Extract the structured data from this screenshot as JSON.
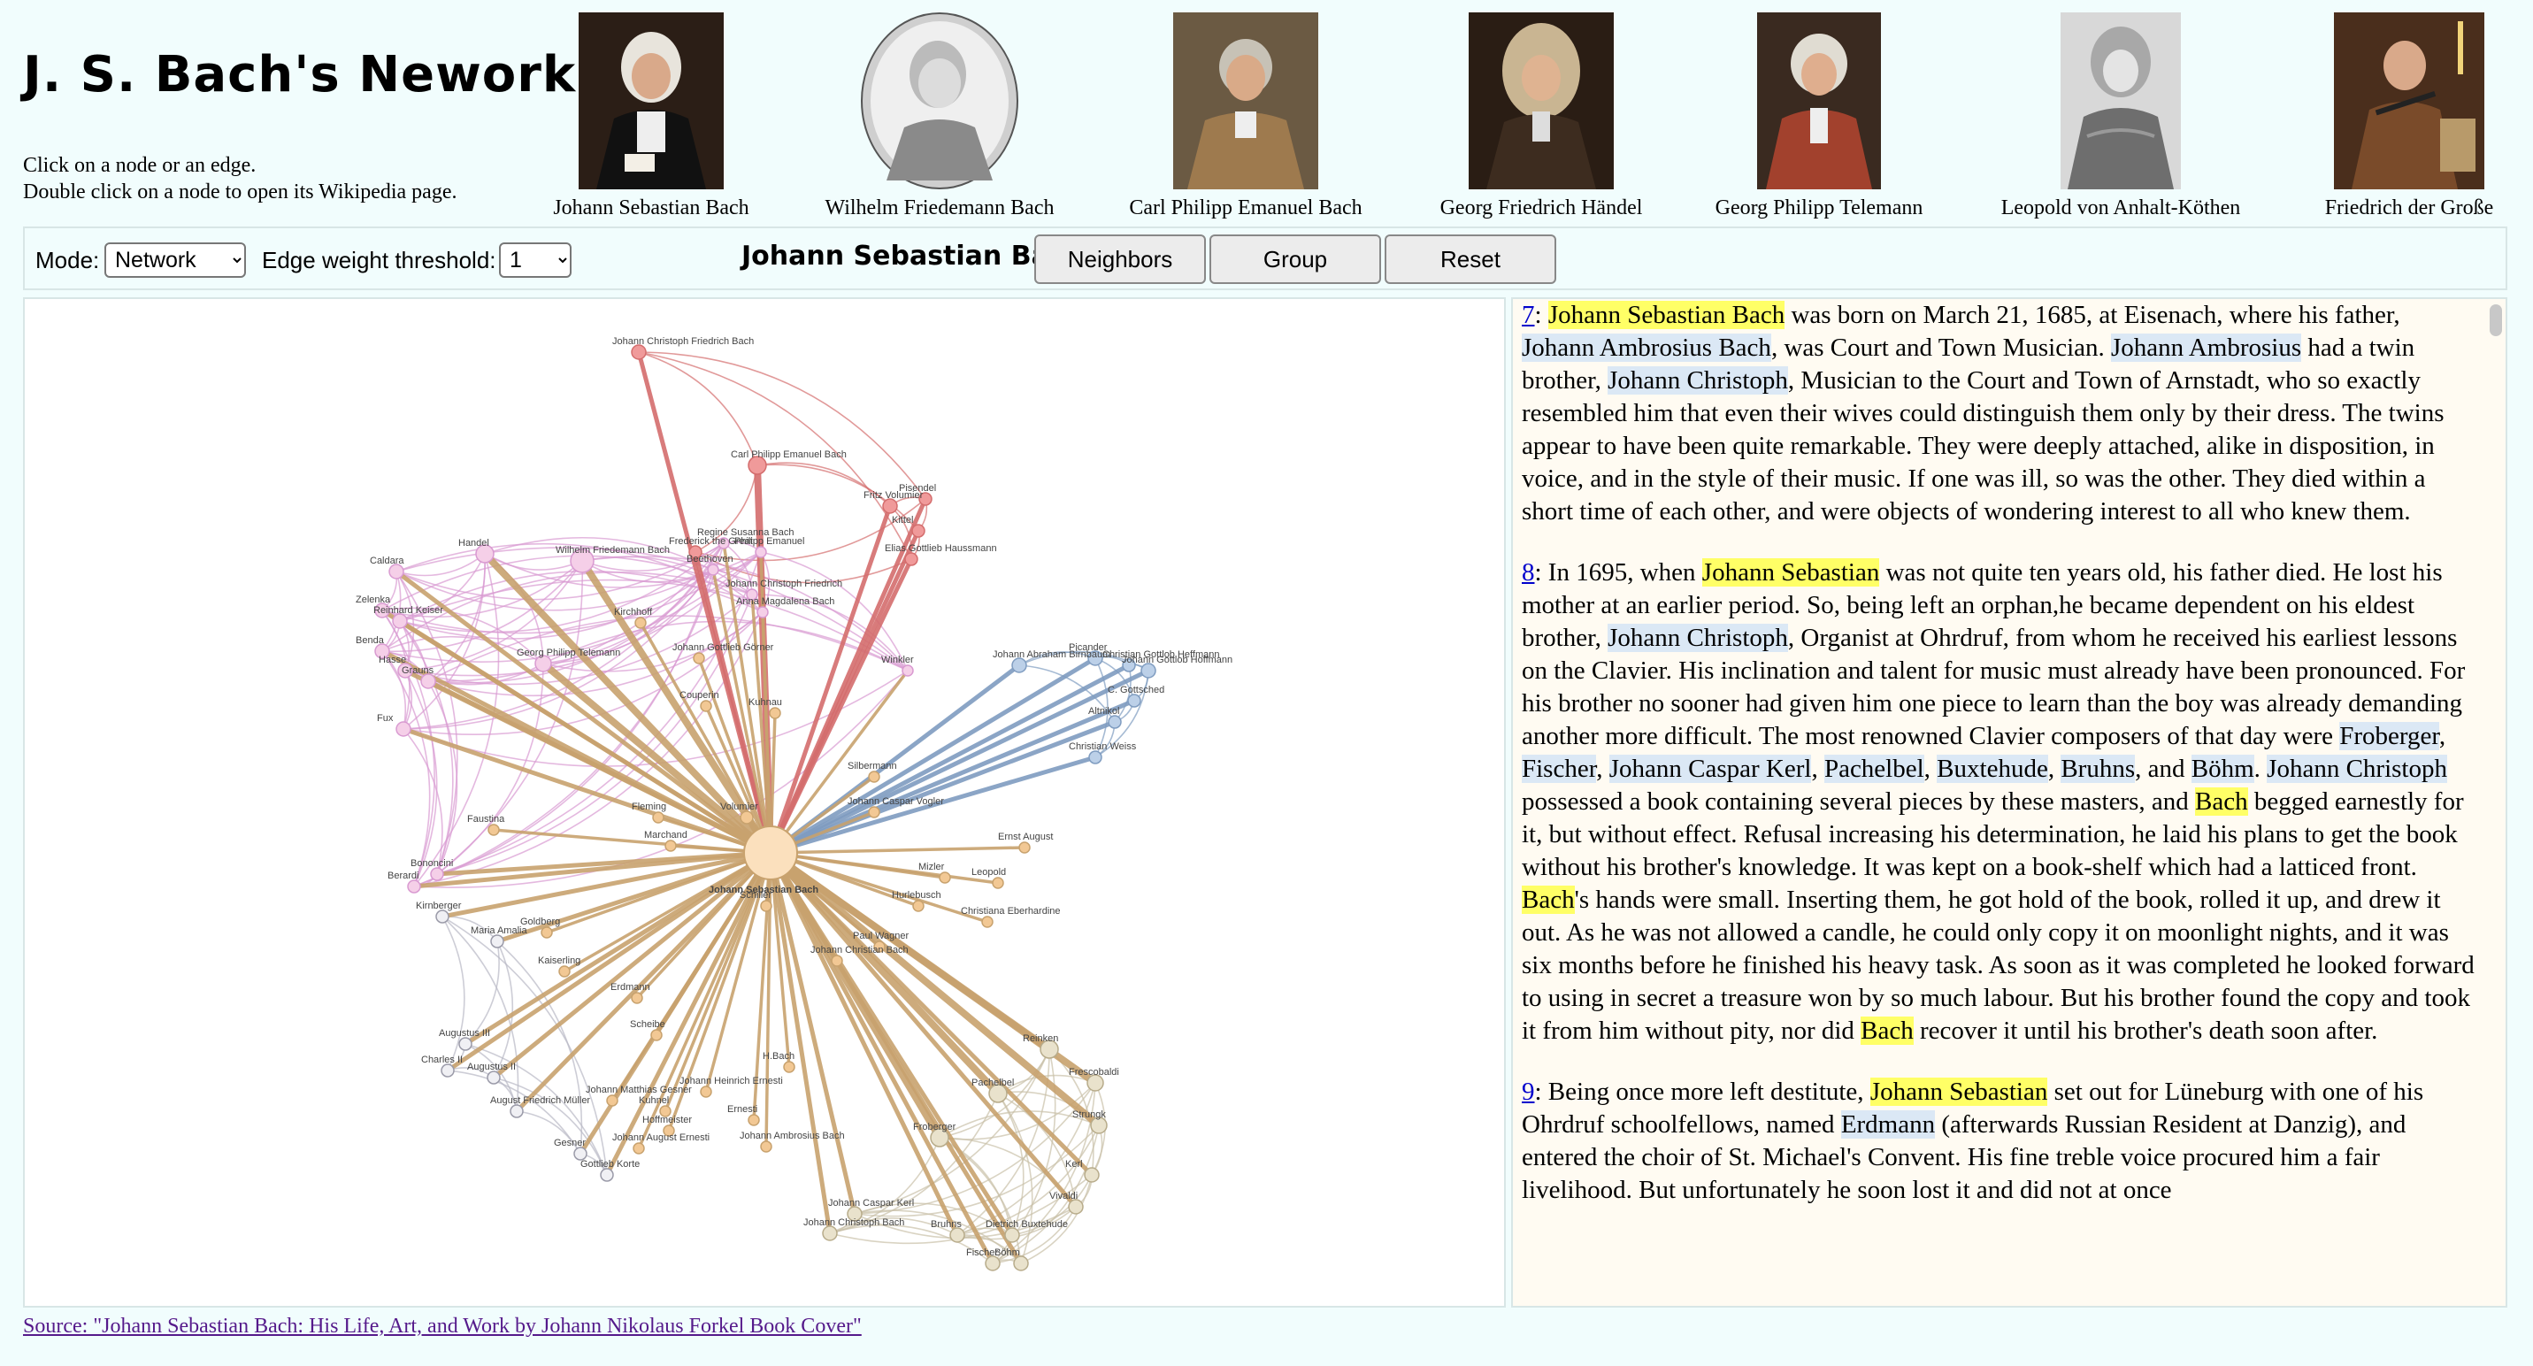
{
  "title": "J. S. Bach's Nework",
  "instructions": {
    "line1": "Click on a node or an edge.",
    "line2": "Double click on a node to open its Wikipedia page."
  },
  "portraits": [
    {
      "name": "Johann Sebastian Bach"
    },
    {
      "name": "Wilhelm Friedemann Bach"
    },
    {
      "name": "Carl Philipp Emanuel Bach"
    },
    {
      "name": "Georg Friedrich Händel"
    },
    {
      "name": "Georg Philipp Telemann"
    },
    {
      "name": "Leopold von Anhalt-Köthen"
    },
    {
      "name": "Friedrich der Große"
    }
  ],
  "toolbar": {
    "mode_label": "Mode:",
    "mode_value": "Network",
    "threshold_label": "Edge weight threshold:",
    "threshold_value": "1",
    "selected_name": "Johann Sebastian Bach",
    "neighbors_label": "Neighbors",
    "group_label": "Group",
    "reset_label": "Reset"
  },
  "graph": {
    "center": "Johann Sebastian Bach",
    "colors": {
      "bach": "#c8a26e",
      "pink": "#d99ad1",
      "red": "#d46d6d",
      "blue": "#7f9cc0",
      "grey": "#b8b8c4",
      "beige": "#c9c0a8"
    },
    "nodes": [
      "Johann Christoph Friedrich Bach",
      "Carl Philipp Emanuel Bach",
      "Fritz Volumier",
      "Pisendel",
      "Kittel",
      "Elias Gottlieb Haussmann",
      "Regine Susanna Bach",
      "Frederick the Great",
      "Philipp Emanuel",
      "Beethoven",
      "Wilhelm Friedemann Bach",
      "Handel",
      "Caldara",
      "Zelenka",
      "Reinhard Keiser",
      "Benda",
      "Kirchhoff",
      "Johann Christoph Friedrich",
      "Anna Magdalena Bach",
      "Johann Gottlieb Görner",
      "Georg Philipp Telemann",
      "Hasse",
      "Grauns",
      "Couperin",
      "Kuhnau",
      "Winkler",
      "Fux",
      "Johann Abraham Birnbaum",
      "Picander",
      "Christian Gottlob Heffmann",
      "Johann Gottlob Hoffmann",
      "C. Gottsched",
      "Altnikol",
      "Christian Weiss",
      "Silbermann",
      "Fleming",
      "Volumier",
      "Johann Caspar Vogler",
      "Faustina",
      "Marchand",
      "Ernst August",
      "Bononcini",
      "Berardi",
      "Mizler",
      "Leopold",
      "Schiller",
      "Kirnberger",
      "Hurlebusch",
      "Christiana Eberhardine",
      "Maria Amalia",
      "Goldberg",
      "Paul Wagner",
      "Johann Christian Bach",
      "Kaiserling",
      "Erdmann",
      "Scheibe",
      "H.Bach",
      "Augustus III",
      "Charles II",
      "Augustus II",
      "Johann Matthias Gesner",
      "Johann Heinrich Ernesti",
      "Kuhnel",
      "Ernesti",
      "Hoffmeister",
      "August Friedrich Müller",
      "Gesner",
      "Johann August Ernesti",
      "Gottlieb Korte",
      "Johann Ambrosius Bach",
      "Reinken",
      "Pachelbel",
      "Frescobaldi",
      "Froberger",
      "Strungk",
      "Kerl",
      "Vivaldi",
      "Johann Caspar Kerl",
      "Johann Christoph Bach",
      "Bruhns",
      "Dietrich Buxtehude",
      "Fischer",
      "Böhm"
    ]
  },
  "text": {
    "p7": {
      "num": "7",
      "t1": "Johann Sebastian Bach",
      "t2": " was born on March 21, 1685, at Eisenach, where his father, ",
      "t3": "Johann Ambrosius Bach",
      "t4": ", was Court and Town Musician. ",
      "t5": "Johann Ambrosius",
      "t6": " had a twin brother, ",
      "t7": "Johann Christoph",
      "t8": ", Musician to the Court and Town of Arnstadt, who so exactly resembled him that even their wives could distinguish them only by their dress. The twins appear to have been quite remarkable. They were deeply attached, alike in disposition, in voice, and in the style of their music. If one was ill, so was the other. They died within a short time of each other, and were objects of wondering interest to all who knew them."
    },
    "p8": {
      "num": "8",
      "t1": ": In 1695, when ",
      "t2": "Johann Sebastian",
      "t3": " was not quite ten years old, his father died. He lost his mother at an earlier period. So, being left an orphan,he became dependent on his eldest brother, ",
      "t4": "Johann Christoph",
      "t5": ", Organist at Ohrdruf, from whom he received his earliest lessons on the Clavier. His inclination and talent for music must already have been pronounced. For his brother no sooner had given him one piece to learn than the boy was already demanding another more difficult. The most renowned Clavier composers of that day were ",
      "t6": "Froberger",
      "t7": ", ",
      "t8": "Fischer",
      "t9": ", ",
      "t10": "Johann Caspar Kerl",
      "t11": ", ",
      "t12": "Pachelbel",
      "t13": ", ",
      "t14": "Buxtehude",
      "t15": ", ",
      "t16": "Bruhns",
      "t17": ", and ",
      "t18": "Böhm",
      "t19": ". ",
      "t20": "Johann Christoph",
      "t21": " possessed a book containing several pieces by these masters, and ",
      "t22": "Bach",
      "t23": " begged earnestly for it, but without effect. Refusal increasing his determination, he laid his plans to get the book without his brother's knowledge. It was kept on a book-shelf which had a latticed front. ",
      "t24": "Bach",
      "t25": "'s hands were small. Inserting them, he got hold of the book, rolled it up, and drew it out. As he was not allowed a candle, he could only copy it on moonlight nights, and it was six months before he finished his heavy task. As soon as it was completed he looked forward to using in secret a treasure won by so much labour. But his brother found the copy and took it from him without pity, nor did ",
      "t26": "Bach",
      "t27": " recover it until his brother's death soon after."
    },
    "p9": {
      "num": "9",
      "t1": ": Being once more left destitute, ",
      "t2": "Johann Sebastian",
      "t3": " set out for Lüneburg with one of his Ohrdruf schoolfellows, named ",
      "t4": "Erdmann",
      "t5": " (afterwards Russian Resident at Danzig), and entered the choir of St. Michael's Convent. His fine treble voice procured him a fair livelihood. But unfortunately he soon lost it and did not at once"
    }
  },
  "source": "Source: \"Johann Sebastian Bach: His Life, Art, and Work by Johann Nikolaus Forkel Book Cover\""
}
